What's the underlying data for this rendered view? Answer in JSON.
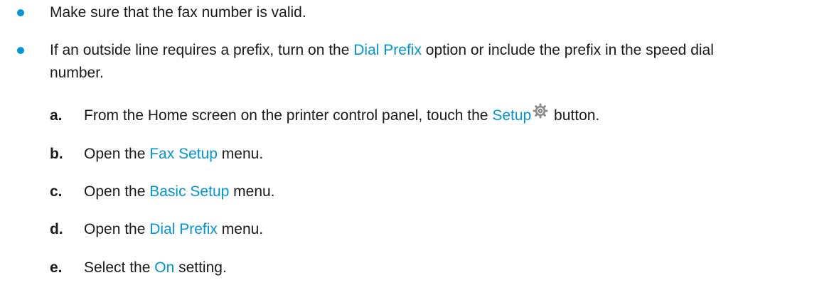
{
  "colors": {
    "accent": "#0096d6",
    "text": "#1a1a1a"
  },
  "bullets": [
    {
      "text": "Make sure that the fax number is valid."
    },
    {
      "text_before": "If an outside line requires a prefix, turn on the ",
      "link": "Dial Prefix",
      "text_after": " option or include the prefix in the speed dial",
      "text_line2": "number."
    }
  ],
  "steps": [
    {
      "letter": "a.",
      "before": "From the Home screen on the printer control panel, touch the ",
      "link": "Setup",
      "icon": "gear-icon",
      "after": " button."
    },
    {
      "letter": "b.",
      "before": "Open the ",
      "link": "Fax Setup",
      "after": " menu."
    },
    {
      "letter": "c.",
      "before": "Open the ",
      "link": "Basic Setup",
      "after": " menu."
    },
    {
      "letter": "d.",
      "before": "Open the ",
      "link": "Dial Prefix",
      "after": " menu."
    },
    {
      "letter": "e.",
      "before": "Select the ",
      "link": "On",
      "after": " setting."
    }
  ]
}
